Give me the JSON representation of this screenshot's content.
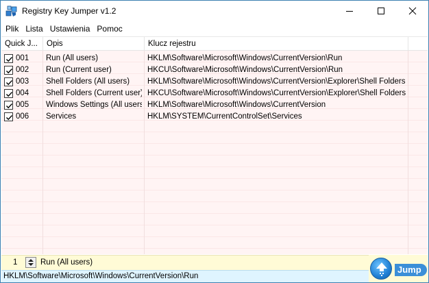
{
  "window": {
    "title": "Registry Key Jumper v1.2"
  },
  "menu": [
    "Plik",
    "Lista",
    "Ustawienia",
    "Pomoc"
  ],
  "list": {
    "columns": [
      "Quick J...",
      "Opis",
      "Klucz rejestru"
    ],
    "rows": [
      {
        "checked": true,
        "num": "001",
        "desc": "Run (All users)",
        "key": "HKLM\\Software\\Microsoft\\Windows\\CurrentVersion\\Run"
      },
      {
        "checked": true,
        "num": "002",
        "desc": "Run (Current user)",
        "key": "HKCU\\Software\\Microsoft\\Windows\\CurrentVersion\\Run"
      },
      {
        "checked": true,
        "num": "003",
        "desc": "Shell Folders (All users)",
        "key": "HKLM\\Software\\Microsoft\\Windows\\CurrentVersion\\Explorer\\Shell Folders"
      },
      {
        "checked": true,
        "num": "004",
        "desc": "Shell Folders (Current user)",
        "key": "HKCU\\Software\\Microsoft\\Windows\\CurrentVersion\\Explorer\\Shell Folders"
      },
      {
        "checked": true,
        "num": "005",
        "desc": "Windows Settings (All users)",
        "key": "HKLM\\Software\\Microsoft\\Windows\\CurrentVersion"
      },
      {
        "checked": true,
        "num": "006",
        "desc": "Services",
        "key": "HKLM\\SYSTEM\\CurrentControlSet\\Services"
      }
    ]
  },
  "jump": {
    "number": "1",
    "description": "Run (All users)",
    "button_label": "Jump"
  },
  "status": {
    "text": "HKLM\\Software\\Microsoft\\Windows\\CurrentVersion\\Run"
  },
  "icons": {
    "app": "registry-cubes-icon",
    "jump": "jump-arrow-icon"
  },
  "colors": {
    "row_background": "#fff4f4",
    "jump_bar": "#fffbd6",
    "status_bar": "#dff4ff",
    "jump_button": "#1f7fd4"
  }
}
